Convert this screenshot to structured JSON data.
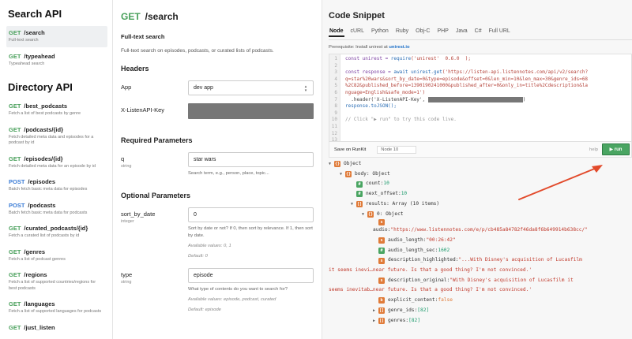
{
  "sidebar": {
    "search_heading": "Search API",
    "directory_heading": "Directory API",
    "search_items": [
      {
        "method": "GET",
        "path": "/search",
        "desc": "Full-text search",
        "active": true
      },
      {
        "method": "GET",
        "path": "/typeahead",
        "desc": "Typeahead search",
        "active": false
      }
    ],
    "directory_items": [
      {
        "method": "GET",
        "path": "/best_podcasts",
        "desc": "Fetch a list of best podcasts by genre"
      },
      {
        "method": "GET",
        "path": "/podcasts/{id}",
        "desc": "Fetch detailed meta data and episodes for a podcast by id"
      },
      {
        "method": "GET",
        "path": "/episodes/{id}",
        "desc": "Fetch detailed meta data for an episode by id"
      },
      {
        "method": "POST",
        "path": "/episodes",
        "desc": "Batch fetch basic meta data for episodes"
      },
      {
        "method": "POST",
        "path": "/podcasts",
        "desc": "Batch fetch basic meta data for podcasts"
      },
      {
        "method": "GET",
        "path": "/curated_podcasts/{id}",
        "desc": "Fetch a curated list of podcasts by id"
      },
      {
        "method": "GET",
        "path": "/genres",
        "desc": "Fetch a list of podcast genres"
      },
      {
        "method": "GET",
        "path": "/regions",
        "desc": "Fetch a list of supported countries/regions for best podcasts"
      },
      {
        "method": "GET",
        "path": "/languages",
        "desc": "Fetch a list of supported languages for podcasts"
      },
      {
        "method": "GET",
        "path": "/just_listen",
        "desc": ""
      }
    ]
  },
  "middle": {
    "method": "GET",
    "path": "/search",
    "subtitle": "Full-text search",
    "description": "Full-text search on episodes, podcasts, or curated lists of podcasts.",
    "headers_title": "Headers",
    "app_label": "App",
    "app_value": "dev app",
    "key_label": "X-ListenAPI-Key",
    "required_title": "Required Parameters",
    "q_label": "q",
    "q_type": "string",
    "q_value": "star wars",
    "q_help": "Search term, e.g., person, place, topic...",
    "optional_title": "Optional Parameters",
    "sort_label": "sort_by_date",
    "sort_type": "integer",
    "sort_value": "0",
    "sort_help": "Sort by date or not? If 0, then sort by relevance. If 1, then sort by date.",
    "sort_allowed": "Available values: 0, 1",
    "sort_default": "Default: 0",
    "type_label": "type",
    "type_type": "string",
    "type_value": "episode",
    "type_help": "What type of contents do you want to search for?",
    "type_allowed": "Available values: episode, podcast, curated",
    "type_default": "Default: episode"
  },
  "snippet": {
    "title": "Code Snippet",
    "tabs": [
      "Node",
      "cURL",
      "Python",
      "Ruby",
      "Obj-C",
      "PHP",
      "Java",
      "C#",
      "Full URL"
    ],
    "active_tab": "Node",
    "prereq_text": "Prerequisite: Install unirest at",
    "prereq_link": "unirest.io",
    "line_numbers": [
      "1",
      "2",
      "3",
      "4",
      "5",
      "6",
      "7",
      "8",
      "9",
      "10",
      "11",
      "12",
      "13"
    ],
    "code_line1_a": "const unirest = ",
    "code_line1_b": "require",
    "code_line1_c": "('unirest'  0.6.0  );",
    "code_line3_a": "const response = ",
    "code_line3_b": "await unirest.get",
    "code_line3_c": "('https://listen-api.listennotes.com/api/v2/search?",
    "code_line4": "q=star%20wars&sort_by_date=0&type=episode&offset=0&len_min=10&len_max=30&genre_ids=68",
    "code_line5": "%2C82&published_before=1390190241000&published_after=0&only_in=title%2Cdescription&la",
    "code_line6": "nguage=English&safe_mode=1')",
    "code_line7_a": "  .header('X-ListenAPI-Key', ",
    "code_line7_b": ")",
    "code_line8": "response.toJSON();",
    "code_line10": "// Click \"▶ run\" to try this code live.",
    "save_label": "Save on RunKit",
    "node_version": "Node 10",
    "help_label": "help",
    "run_label": "▶ run"
  },
  "result": {
    "root": "Object",
    "body": "body: Object",
    "count": "count: ",
    "count_val": "10",
    "next_offset": "next_offset: ",
    "next_offset_val": "10",
    "results": "results: Array (10 items)",
    "item0": "0: Object",
    "audio_key": "audio: ",
    "audio_val": "\"https://www.listennotes.com/e/p/cb485a84782f46da8f6b649914b638cc/\"",
    "audio_length": "audio_length: ",
    "audio_length_val": "\"00:26:42\"",
    "audio_length_sec": "audio_length_sec: ",
    "audio_length_sec_val": "1602",
    "desc_hl": "description_highlighted: ",
    "desc_hl_val1": "\"...With Disney's acquisition of Lucasfilm",
    "desc_hl_val2": "it seems inevi…near future.  Is that a good thing?  I'm not convinced.'",
    "desc_orig": "description_original: ",
    "desc_orig_val1": "\"With Disney's acquisition of Lucasfilm it",
    "desc_orig_val2": "seems inevitab…near future.  Is that a good thing?  I'm not convinced.'",
    "explicit": "explicit_content: ",
    "explicit_val": "false",
    "genre_ids": "genre_ids: ",
    "genre_ids_val": "[82]",
    "genres": "genres: ",
    "genres_val": "[82]"
  },
  "colors": {
    "get": "#49a05b",
    "post": "#3a7bd5",
    "run_button": "#4aa562",
    "arrow": "#e24a2b"
  }
}
